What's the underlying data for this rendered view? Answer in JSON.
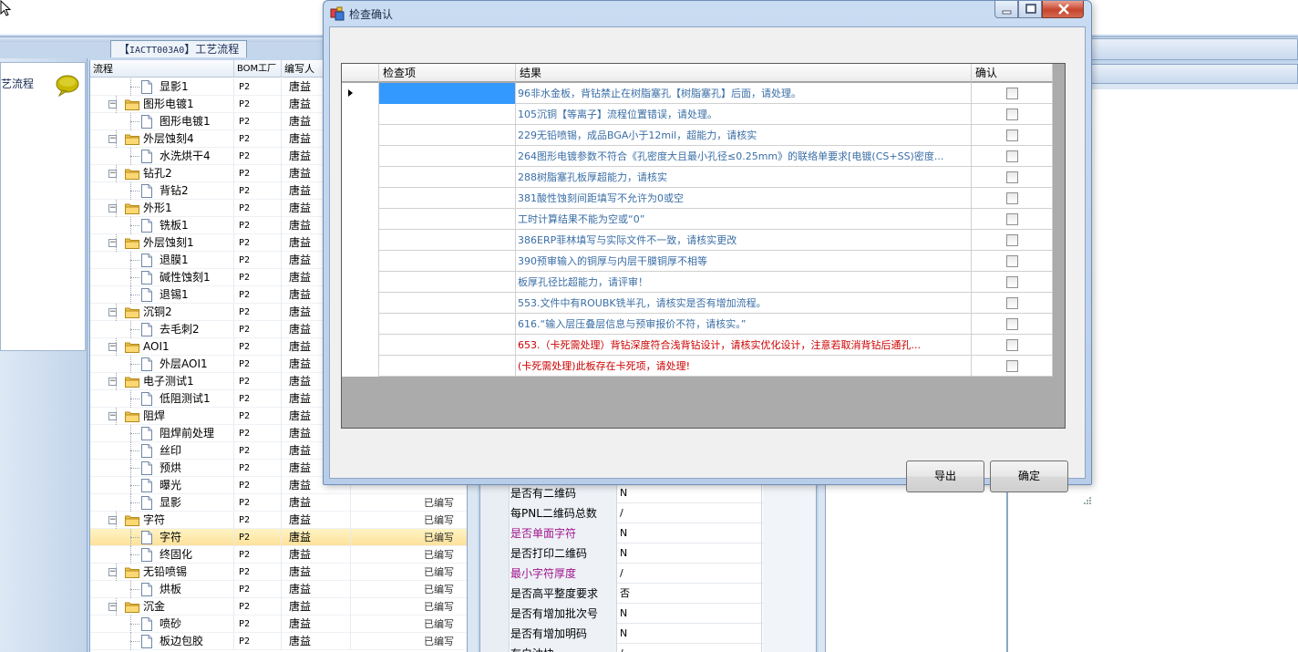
{
  "app": {
    "tab_title_code": "IACTT003A0",
    "tab_title_text": "工艺流程",
    "left_panel_title": "艺流程"
  },
  "tree": {
    "columns": {
      "flow": "流程",
      "bom": "BOM工厂",
      "writer": "编写人"
    },
    "rows": [
      {
        "level": 2,
        "type": "file",
        "name": "显影1",
        "bom": "P2",
        "writer": "唐益",
        "status": ""
      },
      {
        "level": 1,
        "type": "folder",
        "name": "图形电镀1",
        "bom": "P2",
        "writer": "唐益",
        "status": ""
      },
      {
        "level": 2,
        "type": "file",
        "name": "图形电镀1",
        "bom": "P2",
        "writer": "唐益",
        "status": ""
      },
      {
        "level": 1,
        "type": "folder",
        "name": "外层蚀刻4",
        "bom": "P2",
        "writer": "唐益",
        "status": ""
      },
      {
        "level": 2,
        "type": "file",
        "name": "水洗烘干4",
        "bom": "P2",
        "writer": "唐益",
        "status": ""
      },
      {
        "level": 1,
        "type": "folder",
        "name": "钻孔2",
        "bom": "P2",
        "writer": "唐益",
        "status": ""
      },
      {
        "level": 2,
        "type": "file",
        "name": "背钻2",
        "bom": "P2",
        "writer": "唐益",
        "status": ""
      },
      {
        "level": 1,
        "type": "folder",
        "name": "外形1",
        "bom": "P2",
        "writer": "唐益",
        "status": ""
      },
      {
        "level": 2,
        "type": "file",
        "name": "铣板1",
        "bom": "P2",
        "writer": "唐益",
        "status": ""
      },
      {
        "level": 1,
        "type": "folder",
        "name": "外层蚀刻1",
        "bom": "P2",
        "writer": "唐益",
        "status": ""
      },
      {
        "level": 2,
        "type": "file",
        "name": "退膜1",
        "bom": "P2",
        "writer": "唐益",
        "status": ""
      },
      {
        "level": 2,
        "type": "file",
        "name": "碱性蚀刻1",
        "bom": "P2",
        "writer": "唐益",
        "status": ""
      },
      {
        "level": 2,
        "type": "file",
        "name": "退锡1",
        "bom": "P2",
        "writer": "唐益",
        "status": ""
      },
      {
        "level": 1,
        "type": "folder",
        "name": "沉铜2",
        "bom": "P2",
        "writer": "唐益",
        "status": ""
      },
      {
        "level": 2,
        "type": "file",
        "name": "去毛刺2",
        "bom": "P2",
        "writer": "唐益",
        "status": ""
      },
      {
        "level": 1,
        "type": "folder",
        "name": "AOI1",
        "bom": "P2",
        "writer": "唐益",
        "status": ""
      },
      {
        "level": 2,
        "type": "file",
        "name": "外层AOI1",
        "bom": "P2",
        "writer": "唐益",
        "status": ""
      },
      {
        "level": 1,
        "type": "folder",
        "name": "电子测试1",
        "bom": "P2",
        "writer": "唐益",
        "status": ""
      },
      {
        "level": 2,
        "type": "file",
        "name": "低阻测试1",
        "bom": "P2",
        "writer": "唐益",
        "status": ""
      },
      {
        "level": 1,
        "type": "folder",
        "name": "阻焊",
        "bom": "P2",
        "writer": "唐益",
        "status": ""
      },
      {
        "level": 2,
        "type": "file",
        "name": "阻焊前处理",
        "bom": "P2",
        "writer": "唐益",
        "status": ""
      },
      {
        "level": 2,
        "type": "file",
        "name": "丝印",
        "bom": "P2",
        "writer": "唐益",
        "status": ""
      },
      {
        "level": 2,
        "type": "file",
        "name": "预烘",
        "bom": "P2",
        "writer": "唐益",
        "status": ""
      },
      {
        "level": 2,
        "type": "file",
        "name": "曝光",
        "bom": "P2",
        "writer": "唐益",
        "status": ""
      },
      {
        "level": 2,
        "type": "file",
        "name": "显影",
        "bom": "P2",
        "writer": "唐益",
        "status": "已编写"
      },
      {
        "level": 1,
        "type": "folder",
        "name": "字符",
        "bom": "P2",
        "writer": "唐益",
        "status": "已编写"
      },
      {
        "level": 2,
        "type": "file",
        "name": "字符",
        "bom": "P2",
        "writer": "唐益",
        "status": "已编写",
        "selected": true
      },
      {
        "level": 2,
        "type": "file",
        "name": "终固化",
        "bom": "P2",
        "writer": "唐益",
        "status": "已编写"
      },
      {
        "level": 1,
        "type": "folder",
        "name": "无铅喷锡",
        "bom": "P2",
        "writer": "唐益",
        "status": "已编写"
      },
      {
        "level": 2,
        "type": "file",
        "name": "烘板",
        "bom": "P2",
        "writer": "唐益",
        "status": "已编写"
      },
      {
        "level": 1,
        "type": "folder",
        "name": "沉金",
        "bom": "P2",
        "writer": "唐益",
        "status": "已编写"
      },
      {
        "level": 2,
        "type": "file",
        "name": "喷砂",
        "bom": "P2",
        "writer": "唐益",
        "status": "已编写"
      },
      {
        "level": 2,
        "type": "file",
        "name": "板边包胶",
        "bom": "P2",
        "writer": "唐益",
        "status": "已编写"
      }
    ]
  },
  "properties": [
    {
      "name": "是否有二维码",
      "value": "N",
      "highlight": false
    },
    {
      "name": "每PNL二维码总数",
      "value": "/",
      "highlight": false
    },
    {
      "name": "是否单面字符",
      "value": "N",
      "highlight": true
    },
    {
      "name": "是否打印二维码",
      "value": "N",
      "highlight": false
    },
    {
      "name": "最小字符厚度",
      "value": "/",
      "highlight": true
    },
    {
      "name": "是否高平整度要求",
      "value": "否",
      "highlight": false
    },
    {
      "name": "是否有增加批次号",
      "value": "N",
      "highlight": false
    },
    {
      "name": "是否有增加明码",
      "value": "N",
      "highlight": false
    },
    {
      "name": "有白油块",
      "value": "/",
      "highlight": false
    }
  ],
  "dialog": {
    "title": "检查确认",
    "columns": {
      "item": "检查项",
      "result": "结果",
      "confirm": "确认"
    },
    "rows": [
      {
        "result": "96非水金板，背钻禁止在树脂塞孔【树脂塞孔】后面，请处理。",
        "danger": false,
        "checked": false
      },
      {
        "result": "105沉铜【等离子】流程位置错误，请处理。",
        "danger": false,
        "checked": false
      },
      {
        "result": "229无铅喷锡，成品BGA小于12mil，超能力，请核实",
        "danger": false,
        "checked": false
      },
      {
        "result": "264图形电镀参数不符合《孔密度大且最小孔径≤0.25mm》的联络单要求[电镀(CS+SS)密度...",
        "danger": false,
        "checked": false
      },
      {
        "result": "288树脂塞孔板厚超能力，请核实",
        "danger": false,
        "checked": false
      },
      {
        "result": "381酸性蚀刻间距填写不允许为0或空",
        "danger": false,
        "checked": false
      },
      {
        "result": "工时计算结果不能为空或“0”",
        "danger": false,
        "checked": false
      },
      {
        "result": "386ERP菲林填写与实际文件不一致，请核实更改",
        "danger": false,
        "checked": false
      },
      {
        "result": "390预审输入的铜厚与内层干膜铜厚不相等",
        "danger": false,
        "checked": false
      },
      {
        "result": "板厚孔径比超能力，请评审！",
        "danger": false,
        "checked": false
      },
      {
        "result": "553.文件中有ROUBK铣半孔，请核实是否有增加流程。",
        "danger": false,
        "checked": false
      },
      {
        "result": "616.“输入层压叠层信息与预审报价不符，请核实。”",
        "danger": false,
        "checked": false
      },
      {
        "result": "653.（卡死需处理）背钻深度符合浅背钻设计，请核实优化设计，注意若取消背钻后通孔...",
        "danger": true,
        "checked": false
      },
      {
        "result": "(卡死需处理)此板存在卡死项，请处理!",
        "danger": true,
        "checked": false
      }
    ],
    "buttons": {
      "export": "导出",
      "ok": "确定"
    }
  },
  "colors": {
    "result_text": "#3a6ea5",
    "danger_text": "#cc0000",
    "selection": "#3399ff",
    "property_highlight": "#a0158c"
  }
}
